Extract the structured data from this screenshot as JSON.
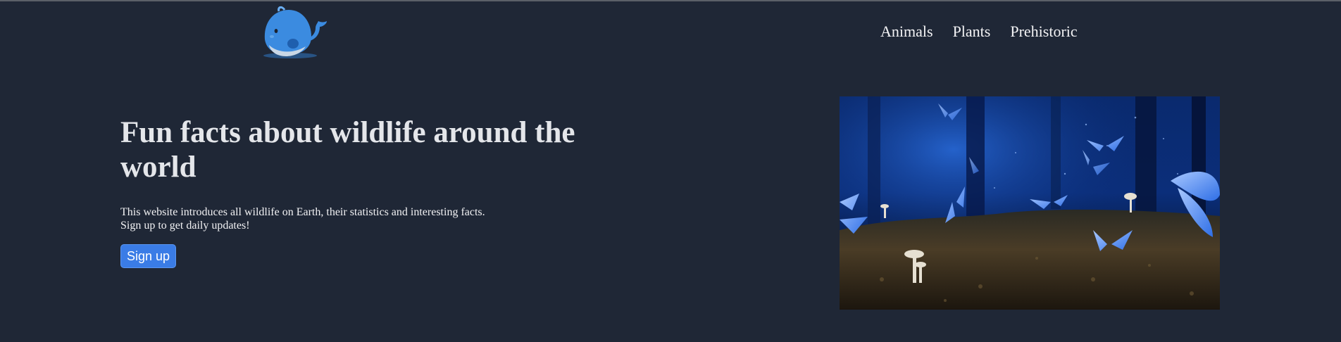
{
  "header": {
    "logo_icon": "whale-icon",
    "nav": [
      {
        "label": "Animals"
      },
      {
        "label": "Plants"
      },
      {
        "label": "Prehistoric"
      }
    ]
  },
  "hero": {
    "title": "Fun facts about wildlife around the world",
    "description_lines": [
      "This website introduces all wildlife on Earth, their statistics and interesting facts.",
      "Sign up to get daily updates!"
    ],
    "signup_label": "Sign up",
    "image_icon": "butterflies-mushrooms-forest-image"
  },
  "colors": {
    "background": "#1f2736",
    "button": "#3a7ce6",
    "whale": "#3b8be0"
  }
}
